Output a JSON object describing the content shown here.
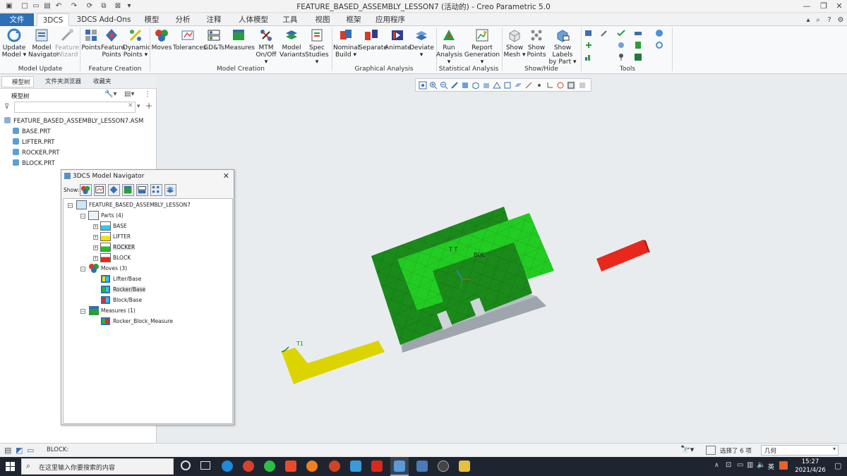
{
  "window": {
    "title": "FEATURE_BASED_ASSEMBLY_LESSON7 (活动的) - Creo Parametric 5.0"
  },
  "tabs": {
    "file": "文件",
    "t3dcs": "3DCS",
    "addons": "3DCS Add-Ons",
    "model": "模型",
    "analysis": "分析",
    "annotate": "注释",
    "human": "人体模型",
    "tools": "工具",
    "view": "视图",
    "framework": "框架",
    "apps": "应用程序"
  },
  "ribbon": {
    "update_model": [
      "Update",
      "Model ▾"
    ],
    "model_navigator": [
      "Model",
      "Navigator"
    ],
    "feature_wizard": [
      "Feature",
      "Wizard"
    ],
    "points": [
      "Points",
      ""
    ],
    "feature_points": [
      "Feature",
      "Points"
    ],
    "dynamic_points": [
      "Dynamic",
      "Points ▾"
    ],
    "moves": [
      "Moves",
      ""
    ],
    "tolerances": [
      "Tolerances",
      ""
    ],
    "gdts": [
      "GD&Ts",
      ""
    ],
    "measures": [
      "Measures",
      ""
    ],
    "mtm": [
      "MTM",
      "On/Off ▾"
    ],
    "model_variants": [
      "Model",
      "Variants"
    ],
    "spec_studies": [
      "Spec",
      "Studies ▾"
    ],
    "nominal_build": [
      "Nominal",
      "Build ▾"
    ],
    "separate": [
      "Separate",
      ""
    ],
    "animate": [
      "Animate",
      ""
    ],
    "deviate": [
      "Deviate",
      "▾"
    ],
    "run_analysis": [
      "Run",
      "Analysis ▾"
    ],
    "report_generation": [
      "Report",
      "Generation ▾"
    ],
    "show_mesh": [
      "Show",
      "Mesh ▾"
    ],
    "show_points": [
      "Show",
      "Points"
    ],
    "show_labels": [
      "Show Labels",
      "by Part ▾"
    ],
    "groups": {
      "model_update": "Model Update",
      "feature_creation": "Feature Creation",
      "model_creation": "Model Creation",
      "graphical_analysis": "Graphical Analysis",
      "statistical_analysis": "Statistical Analysis",
      "show_hide": "Show/Hide",
      "tools": "Tools"
    }
  },
  "left_panel": {
    "tabs": [
      "模型树",
      "文件夹浏览器",
      "收藏夹"
    ],
    "header": "模型树",
    "assembly": "FEATURE_BASED_ASSEMBLY_LESSON7.ASM",
    "parts": [
      "BASE.PRT",
      "LIFTER.PRT",
      "ROCKER.PRT",
      "BLOCK.PRT"
    ]
  },
  "navigator": {
    "title": "3DCS Model Navigator",
    "show_label": "Show:",
    "root": "FEATURE_BASED_ASSEMBLY_LESSON7",
    "parts_label": "Parts (4)",
    "parts": [
      {
        "name": "BASE",
        "color": "#2fc6f0"
      },
      {
        "name": "LIFTER",
        "color": "#f2e400"
      },
      {
        "name": "ROCKER",
        "color": "#1fc21f"
      },
      {
        "name": "BLOCK",
        "color": "#e8281c"
      }
    ],
    "moves_label": "Moves (3)",
    "moves": [
      "Lifter/Base",
      "Rocker/Base",
      "Block/Base"
    ],
    "measures_label": "Measures (1)",
    "measures": [
      "Rocker_Block_Measure"
    ]
  },
  "viewport": {
    "labels": [
      "T1",
      "T T",
      "BOL"
    ]
  },
  "status": {
    "message": "BLOCK:",
    "selection": "选择了 6 项",
    "filter": "几何"
  },
  "taskbar": {
    "search_placeholder": "在这里输入你要搜索的内容",
    "time": "15:27",
    "date": "2021/4/26",
    "lang": "英"
  },
  "colors": {
    "accent": "#2f6fb4",
    "base_part": "#1a8a1a",
    "rocker_part": "#22cc22",
    "lifter_part": "#e8e000",
    "block_part": "#e8281c",
    "plate": "#b8bec6"
  }
}
